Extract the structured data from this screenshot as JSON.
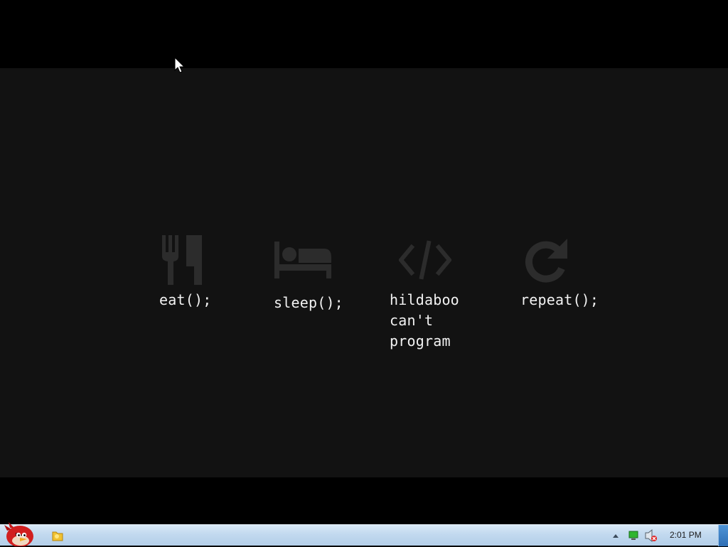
{
  "desktop": {
    "items": [
      {
        "label": "eat();",
        "icon": "fork-knife-icon"
      },
      {
        "label": "sleep();",
        "icon": "bed-icon"
      },
      {
        "label": "hildaboo\ncan't\nprogram",
        "icon": "code-icon"
      },
      {
        "label": "repeat();",
        "icon": "refresh-icon"
      }
    ]
  },
  "taskbar": {
    "start_icon": "angry-bird-start-orb",
    "pinned_app_icon": "folder-icon",
    "tray_icons": [
      "show-hidden-icons-arrow",
      "network-icon",
      "speaker-muted-icon"
    ],
    "clock": "2:01 PM"
  },
  "colors": {
    "wallpaper": "#121212",
    "icon_gray": "#2c2c2c",
    "label_text": "#f2f2f2",
    "taskbar": "#c2d9ef"
  }
}
